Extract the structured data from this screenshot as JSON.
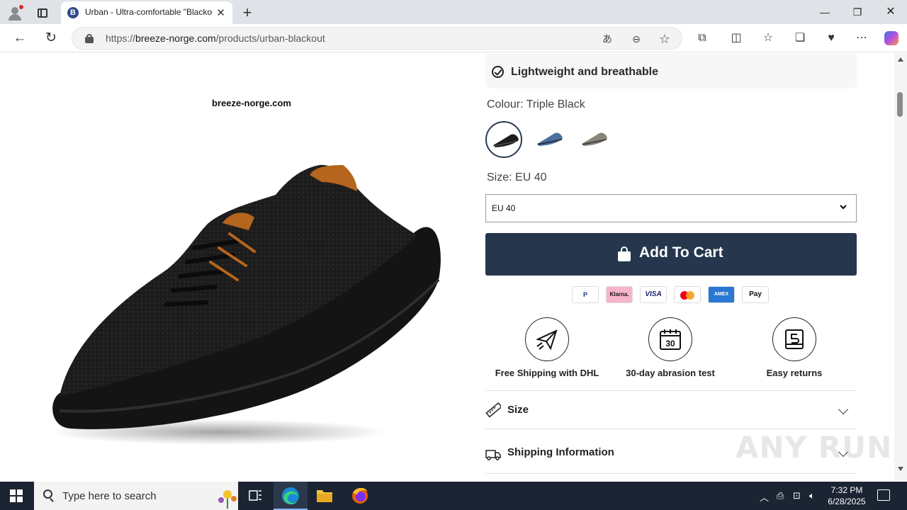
{
  "browser": {
    "tab_title": "Urban - Ultra-comfortable \"Blackout\"",
    "tab_favicon_letter": "B",
    "url_prefix": "https://",
    "url_domain": "breeze-norge.com",
    "url_path": "/products/urban-blackout",
    "icons": [
      "profile-icon",
      "tab-actions-icon",
      "close-icon",
      "plus-icon",
      "minimize-icon",
      "restore-icon",
      "back-icon",
      "reload-icon",
      "lock-icon",
      "translate-icon",
      "reader-icon",
      "star-icon",
      "extensions-icon",
      "split-icon",
      "favorites-icon",
      "collections-icon",
      "performance-icon",
      "more-icon",
      "copilot-icon"
    ]
  },
  "product": {
    "image_watermark_text": "breeze-norge.com",
    "feature": "Lightweight and breathable",
    "colour_label": "Colour: Triple Black",
    "swatches": [
      "Triple Black",
      "Blue",
      "Grey"
    ],
    "size_label": "Size: EU 40",
    "size_value": "EU 40",
    "add_to_cart": "Add To Cart",
    "payment_methods": [
      "PayPal",
      "Klarna.",
      "VISA",
      "Mastercard",
      "AMEX",
      "Apple Pay"
    ],
    "payment_text": {
      "paypal": "P",
      "klarna": "Klarna.",
      "visa": "VISA",
      "amex": "AMEX",
      "applepay": " Pay"
    },
    "perks": [
      {
        "label": "Free Shipping with DHL",
        "icon": "paper-plane-icon"
      },
      {
        "label": "30-day abrasion test",
        "icon": "calendar-30-icon"
      },
      {
        "label": "Easy returns",
        "icon": "return-box-icon"
      }
    ],
    "accordion": [
      {
        "label": "Size",
        "icon": "ruler-icon"
      },
      {
        "label": "Shipping Information",
        "icon": "truck-icon"
      }
    ]
  },
  "overlay": {
    "watermark": "ANY RUN"
  },
  "taskbar": {
    "search_placeholder": "Type here to search",
    "time": "7:32 PM",
    "date": "6/28/2025"
  }
}
